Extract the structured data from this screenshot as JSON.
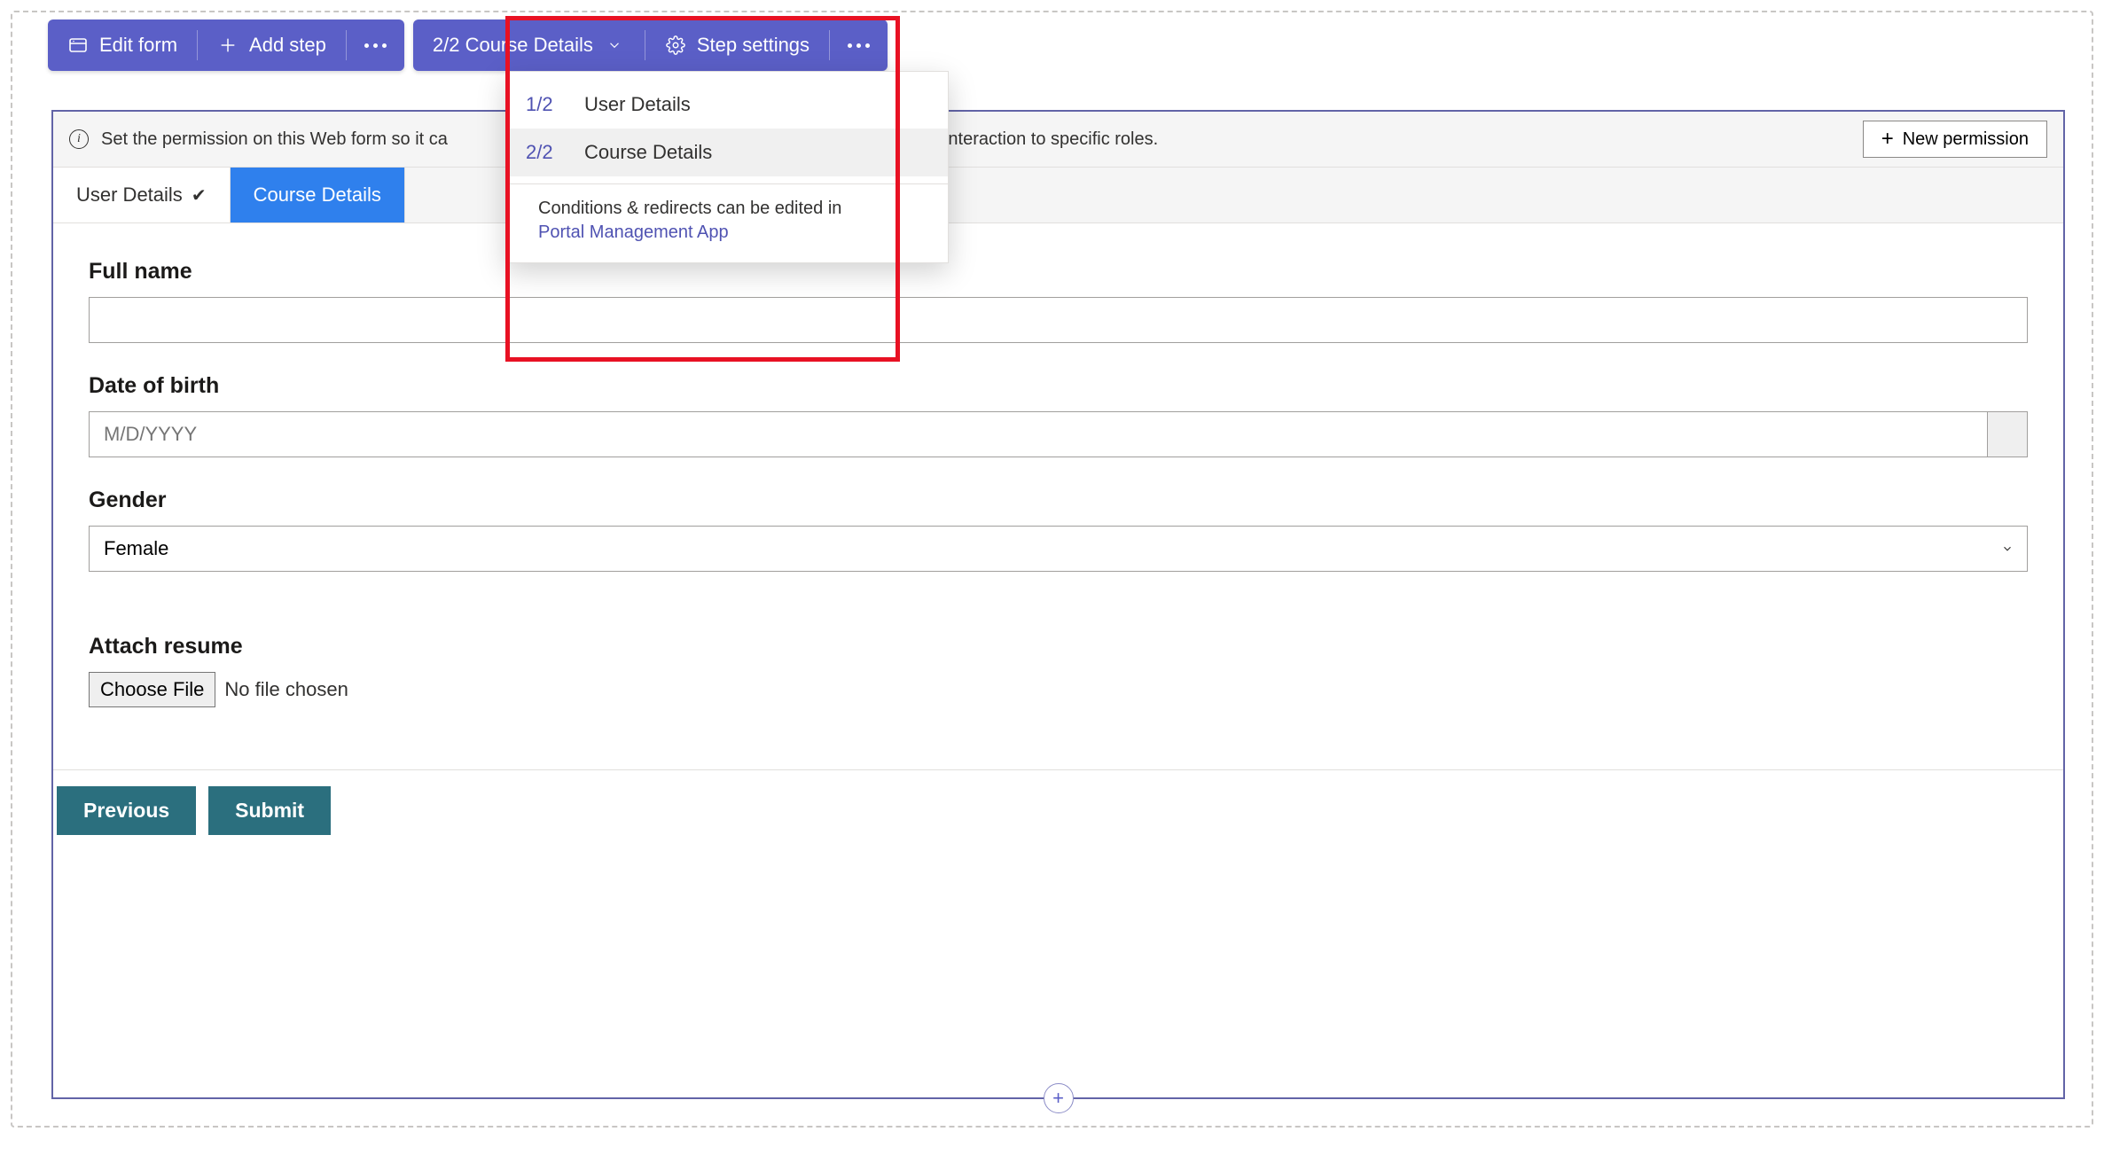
{
  "toolbar1": {
    "edit_form": "Edit form",
    "add_step": "Add step"
  },
  "toolbar2": {
    "step_selector": "2/2 Course Details",
    "step_settings": "Step settings"
  },
  "dropdown": {
    "items": [
      {
        "num": "1/2",
        "label": "User Details"
      },
      {
        "num": "2/2",
        "label": "Course Details"
      }
    ],
    "footer_text": "Conditions & redirects can be edited in",
    "footer_link": "Portal Management App"
  },
  "info": {
    "text_before": "Set the permission on this Web form so it ca",
    "text_after": " limit the interaction to specific roles.",
    "new_permission": "New permission"
  },
  "tabs": {
    "t1": "User Details",
    "t2": "Course Details"
  },
  "form": {
    "full_name_label": "Full name",
    "full_name_value": "",
    "dob_label": "Date of birth",
    "dob_placeholder": "M/D/YYYY",
    "gender_label": "Gender",
    "gender_value": "Female",
    "attach_label": "Attach resume",
    "choose_file": "Choose File",
    "no_file": "No file chosen"
  },
  "actions": {
    "previous": "Previous",
    "submit": "Submit"
  }
}
